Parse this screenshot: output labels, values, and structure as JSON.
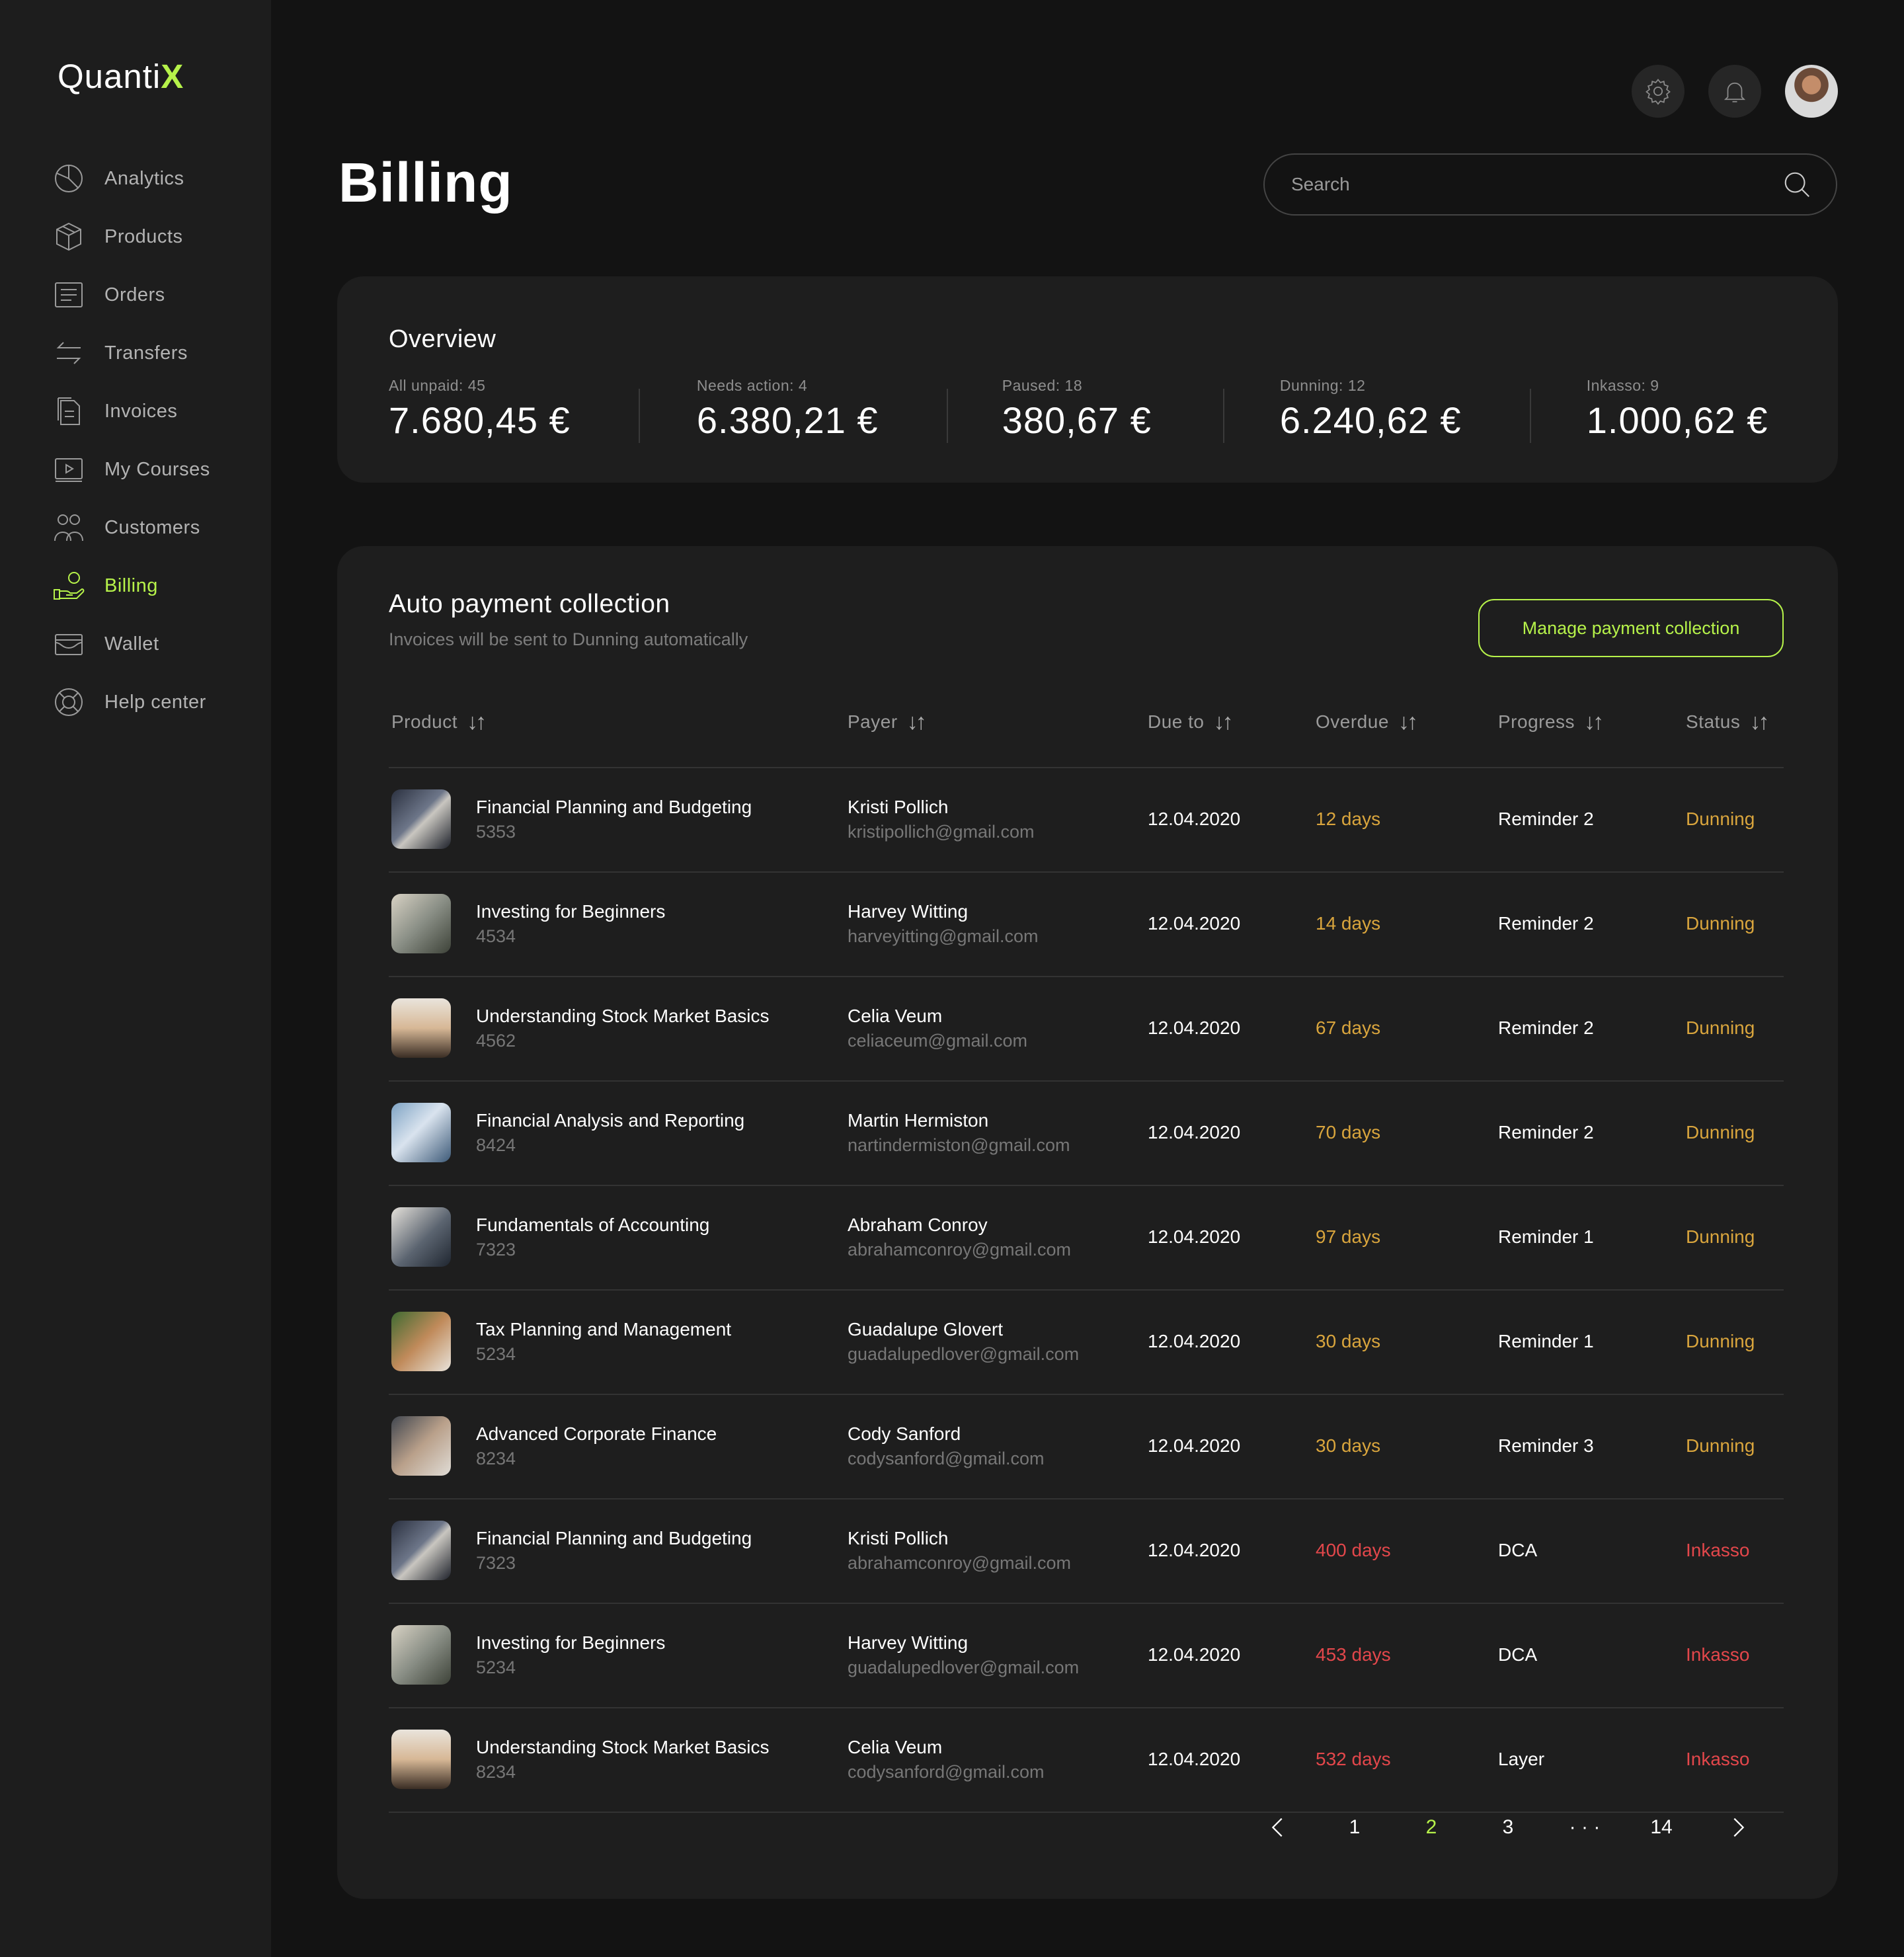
{
  "app": {
    "logo_text": "Quanti",
    "logo_accent": "X"
  },
  "colors": {
    "accent": "#b6f24a",
    "warning": "#d9a53d",
    "danger": "#e3474b",
    "background": "#131313",
    "panel": "#1e1e1e"
  },
  "sidebar": {
    "items": [
      {
        "label": "Analytics",
        "icon": "pie-chart-icon"
      },
      {
        "label": "Products",
        "icon": "box-icon"
      },
      {
        "label": "Orders",
        "icon": "receipt-icon"
      },
      {
        "label": "Transfers",
        "icon": "arrows-icon"
      },
      {
        "label": "Invoices",
        "icon": "document-icon"
      },
      {
        "label": "My Courses",
        "icon": "video-icon"
      },
      {
        "label": "Customers",
        "icon": "users-icon"
      },
      {
        "label": "Billing",
        "icon": "hand-coin-icon",
        "active": true
      },
      {
        "label": "Wallet",
        "icon": "wallet-icon"
      },
      {
        "label": "Help center",
        "icon": "lifebuoy-icon"
      }
    ]
  },
  "header": {
    "title": "Billing",
    "search_placeholder": "Search"
  },
  "overview": {
    "title": "Overview",
    "stats": [
      {
        "label": "All unpaid: 45",
        "value": "7.680,45 €"
      },
      {
        "label": "Needs action: 4",
        "value": "6.380,21 €"
      },
      {
        "label": "Paused: 18",
        "value": "380,67 €"
      },
      {
        "label": "Dunning: 12",
        "value": "6.240,62 €"
      },
      {
        "label": "Inkasso: 9",
        "value": "1.000,62 €"
      }
    ]
  },
  "collection": {
    "title": "Auto payment collection",
    "subtitle": "Invoices will be sent to Dunning automatically",
    "manage_label": "Manage payment collection",
    "columns": [
      "Product",
      "Payer",
      "Due to",
      "Overdue",
      "Progress",
      "Status"
    ],
    "rows": [
      {
        "product": "Financial Planning and Budgeting",
        "id": "5353",
        "payer": "Kristi Pollich",
        "email": "kristipollich@gmail.com",
        "due": "12.04.2020",
        "overdue": "12 days",
        "progress": "Reminder 2",
        "status": "Dunning",
        "severity": "warn",
        "thumb": "thumb-a"
      },
      {
        "product": "Investing for Beginners",
        "id": "4534",
        "payer": "Harvey Witting",
        "email": "harveyitting@gmail.com",
        "due": "12.04.2020",
        "overdue": "14 days",
        "progress": "Reminder 2",
        "status": "Dunning",
        "severity": "warn",
        "thumb": "thumb-b"
      },
      {
        "product": "Understanding Stock Market Basics",
        "id": "4562",
        "payer": "Celia Veum",
        "email": "celiaceum@gmail.com",
        "due": "12.04.2020",
        "overdue": "67 days",
        "progress": "Reminder 2",
        "status": "Dunning",
        "severity": "warn",
        "thumb": "thumb-c"
      },
      {
        "product": "Financial Analysis and Reporting",
        "id": "8424",
        "payer": "Martin Hermiston",
        "email": "nartindermiston@gmail.com",
        "due": "12.04.2020",
        "overdue": "70 days",
        "progress": "Reminder 2",
        "status": "Dunning",
        "severity": "warn",
        "thumb": "thumb-d"
      },
      {
        "product": "Fundamentals of Accounting",
        "id": "7323",
        "payer": "Abraham Conroy",
        "email": "abrahamconroy@gmail.com",
        "due": "12.04.2020",
        "overdue": "97 days",
        "progress": "Reminder 1",
        "status": "Dunning",
        "severity": "warn",
        "thumb": "thumb-e"
      },
      {
        "product": "Tax Planning and Management",
        "id": "5234",
        "payer": "Guadalupe Glovert",
        "email": "guadalupedlover@gmail.com",
        "due": "12.04.2020",
        "overdue": "30 days",
        "progress": "Reminder 1",
        "status": "Dunning",
        "severity": "warn",
        "thumb": "thumb-f"
      },
      {
        "product": "Advanced Corporate Finance",
        "id": "8234",
        "payer": "Cody Sanford",
        "email": "codysanford@gmail.com",
        "due": "12.04.2020",
        "overdue": "30 days",
        "progress": "Reminder 3",
        "status": "Dunning",
        "severity": "warn",
        "thumb": "thumb-g"
      },
      {
        "product": "Financial Planning and Budgeting",
        "id": "7323",
        "payer": "Kristi Pollich",
        "email": "abrahamconroy@gmail.com",
        "due": "12.04.2020",
        "overdue": "400 days",
        "progress": "DCA",
        "status": "Inkasso",
        "severity": "danger",
        "thumb": "thumb-a"
      },
      {
        "product": "Investing for Beginners",
        "id": "5234",
        "payer": "Harvey Witting",
        "email": "guadalupedlover@gmail.com",
        "due": "12.04.2020",
        "overdue": "453  days",
        "progress": "DCA",
        "status": "Inkasso",
        "severity": "danger",
        "thumb": "thumb-b"
      },
      {
        "product": "Understanding Stock Market Basics",
        "id": "8234",
        "payer": "Celia Veum",
        "email": "codysanford@gmail.com",
        "due": "12.04.2020",
        "overdue": "532  days",
        "progress": "Layer",
        "status": "Inkasso",
        "severity": "danger",
        "thumb": "thumb-c"
      }
    ]
  },
  "pagination": {
    "pages": [
      "1",
      "2",
      "3",
      "· · ·",
      "14"
    ],
    "current": "2"
  }
}
